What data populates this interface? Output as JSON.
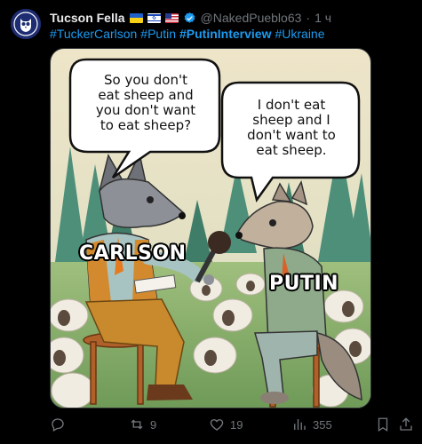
{
  "tweet": {
    "display_name": "Tucson Fella",
    "flags": [
      "ukraine-flag",
      "israel-flag",
      "us-flag"
    ],
    "handle": "@NakedPueblo63",
    "separator": "·",
    "time": "1 ч",
    "hashtags": [
      {
        "text": "#TuckerCarlson",
        "bold": false
      },
      {
        "text": "#Putin",
        "bold": false
      },
      {
        "text": "#PutinInterview",
        "bold": true
      },
      {
        "text": "#Ukraine",
        "bold": false
      }
    ],
    "image": {
      "bubble_left": [
        "So you don't",
        "eat sheep and",
        "you don't want",
        "to eat sheep?"
      ],
      "bubble_right": [
        "I don't eat",
        "sheep and I",
        "don't want to",
        "eat sheep."
      ],
      "label_left": "CARLSON",
      "label_right": "PUTIN"
    },
    "actions": {
      "reply_icon": "reply-icon",
      "retweets": "9",
      "likes": "19",
      "views": "355"
    }
  },
  "colors": {
    "background": "#000000",
    "text_primary": "#e7e9ea",
    "text_secondary": "#71767b",
    "link": "#1d9bf0"
  }
}
